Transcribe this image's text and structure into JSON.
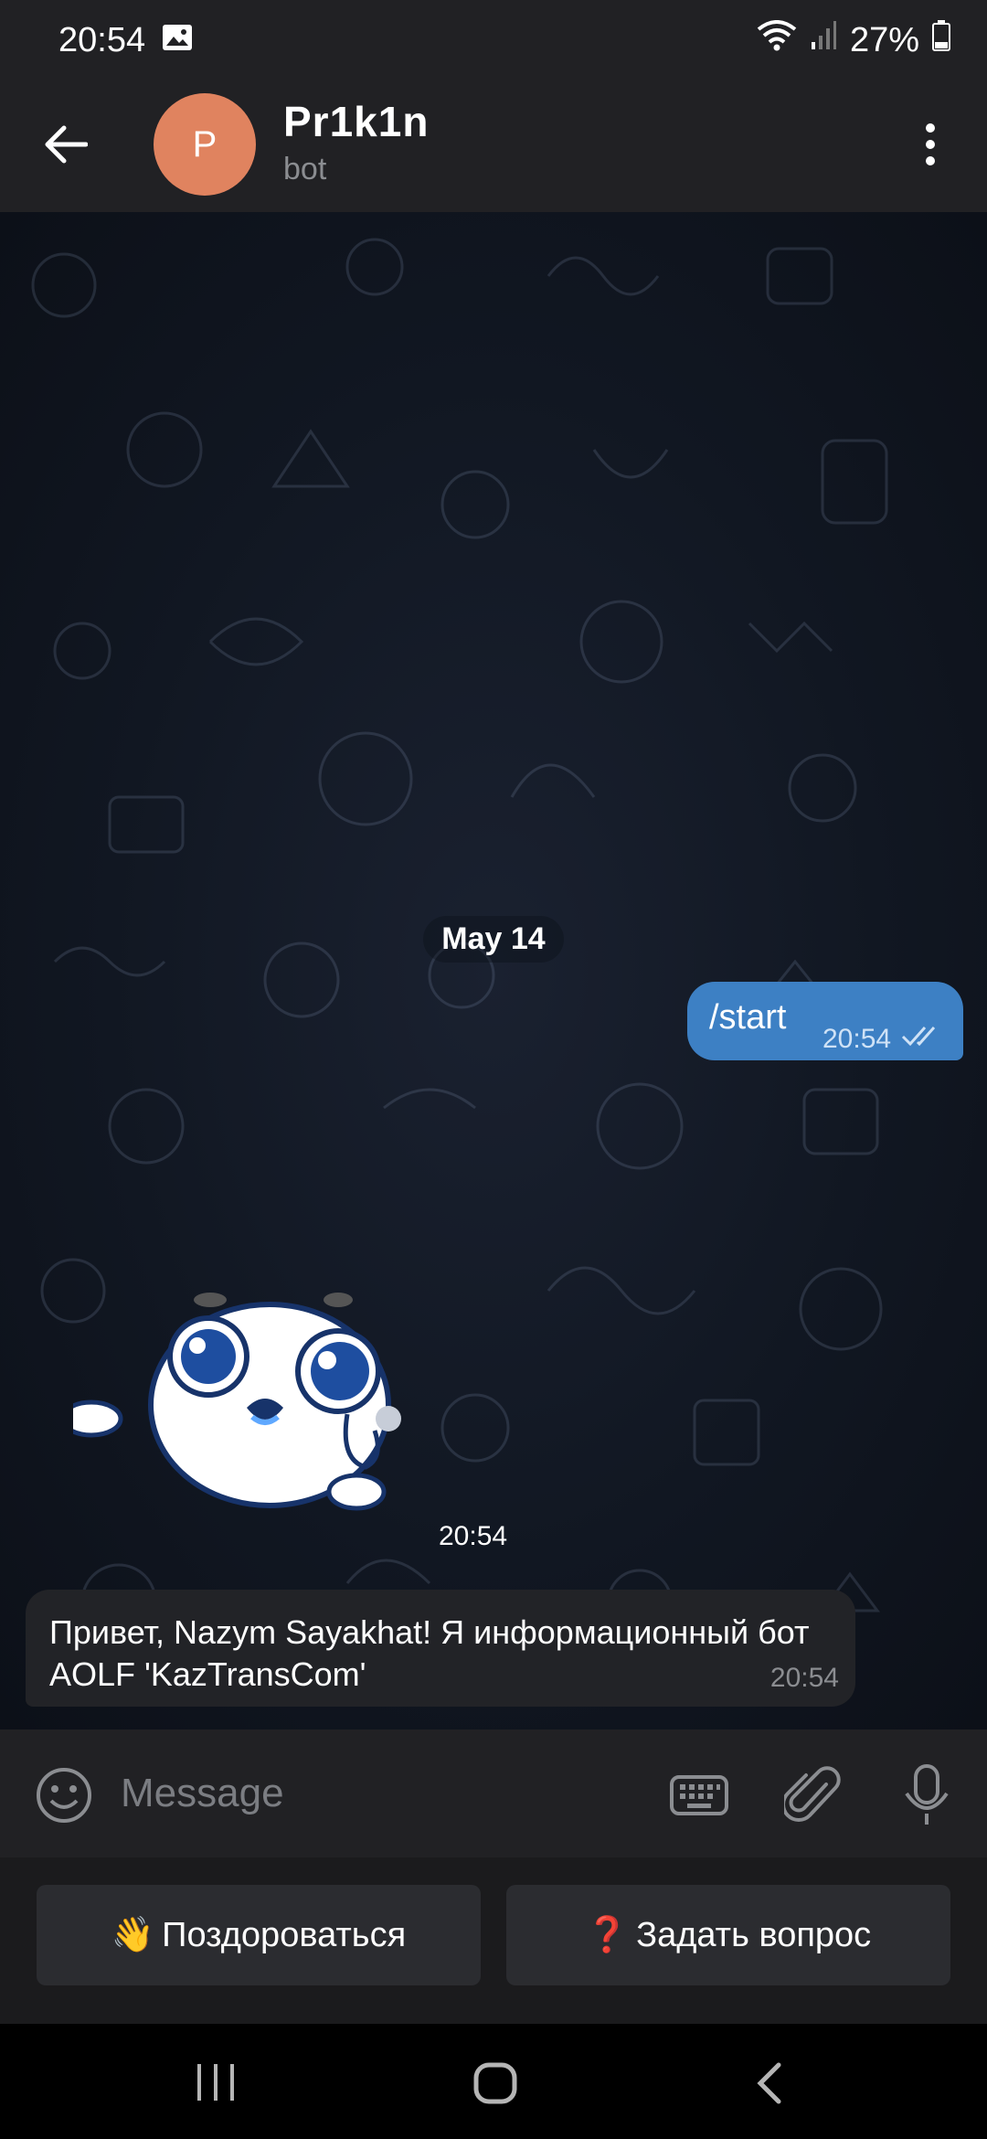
{
  "status_bar": {
    "time": "20:54",
    "battery": "27%",
    "icons": [
      "image-icon",
      "wifi-icon",
      "signal-icon",
      "battery-icon"
    ]
  },
  "header": {
    "avatar_letter": "P",
    "avatar_color": "#e0835f",
    "title": "Pr1k1n",
    "subtitle": "bot",
    "icons": [
      "back-arrow-icon",
      "more-vertical-icon"
    ]
  },
  "chat": {
    "date_separator": "May 14",
    "outgoing": {
      "text": "/start",
      "time": "20:54",
      "status": "read"
    },
    "sticker": {
      "description_icon": "seal-sticker",
      "time": "20:54"
    },
    "incoming": {
      "text": "Привет, Nazym Sayakhat! Я информационный бот AOLF 'KazTransCom'",
      "time": "20:54"
    }
  },
  "input_bar": {
    "placeholder": "Message",
    "icons": [
      "emoji-icon",
      "keyboard-icon",
      "attach-icon",
      "mic-icon"
    ]
  },
  "bot_keyboard": {
    "buttons": [
      {
        "emoji": "👋",
        "label": "Поздороваться"
      },
      {
        "emoji": "❓",
        "label": "Задать вопрос"
      }
    ]
  },
  "colors": {
    "outgoing_bubble": "#3d80c4",
    "incoming_bubble": "#222327",
    "header_bg": "#212124"
  }
}
